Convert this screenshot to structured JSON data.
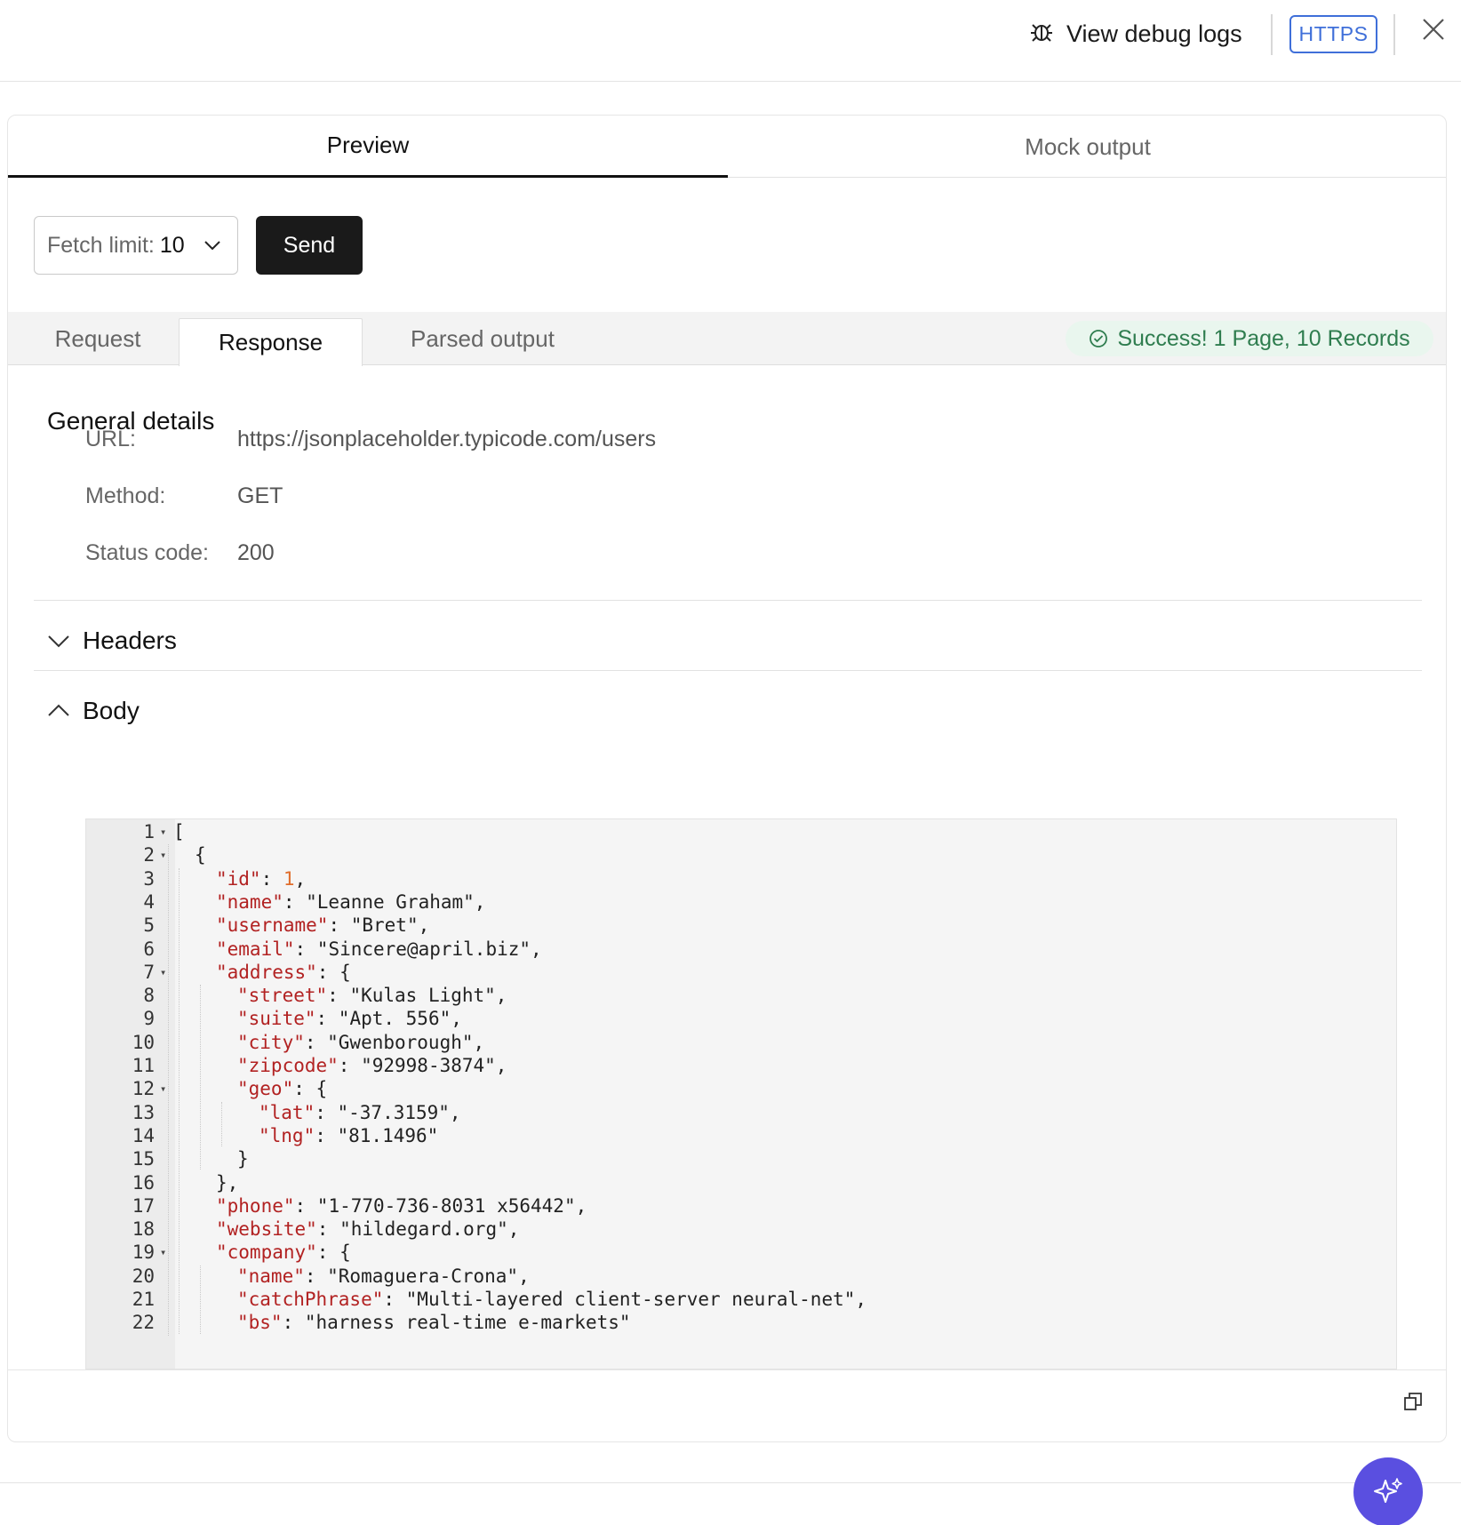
{
  "topbar": {
    "debug_label": "View debug logs",
    "https_label": "HTTPS"
  },
  "tabs": {
    "preview": "Preview",
    "mock": "Mock output"
  },
  "fetch": {
    "label": "Fetch limit:",
    "value": "10",
    "send_label": "Send"
  },
  "subtabs": {
    "request": "Request",
    "response": "Response",
    "parsed": "Parsed output",
    "success": "Success! 1 Page, 10 Records"
  },
  "general": {
    "title": "General details",
    "url_label": "URL:",
    "url_value": "https://jsonplaceholder.typicode.com/users",
    "method_label": "Method:",
    "method_value": "GET",
    "status_label": "Status code:",
    "status_value": "200"
  },
  "sections": {
    "headers": "Headers",
    "body": "Body"
  },
  "code": {
    "lines": [
      {
        "n": "1",
        "fold": true,
        "d": 0,
        "p": [
          [
            "t",
            "["
          ]
        ]
      },
      {
        "n": "2",
        "fold": true,
        "d": 1,
        "p": [
          [
            "t",
            "{"
          ]
        ]
      },
      {
        "n": "3",
        "fold": false,
        "d": 2,
        "p": [
          [
            "k",
            "\"id\""
          ],
          [
            "t",
            ": "
          ],
          [
            "n",
            "1"
          ],
          [
            "t",
            ","
          ]
        ]
      },
      {
        "n": "4",
        "fold": false,
        "d": 2,
        "p": [
          [
            "k",
            "\"name\""
          ],
          [
            "t",
            ": \"Leanne Graham\","
          ]
        ]
      },
      {
        "n": "5",
        "fold": false,
        "d": 2,
        "p": [
          [
            "k",
            "\"username\""
          ],
          [
            "t",
            ": \"Bret\","
          ]
        ]
      },
      {
        "n": "6",
        "fold": false,
        "d": 2,
        "p": [
          [
            "k",
            "\"email\""
          ],
          [
            "t",
            ": \"Sincere@april.biz\","
          ]
        ]
      },
      {
        "n": "7",
        "fold": true,
        "d": 2,
        "p": [
          [
            "k",
            "\"address\""
          ],
          [
            "t",
            ": {"
          ]
        ]
      },
      {
        "n": "8",
        "fold": false,
        "d": 3,
        "p": [
          [
            "k",
            "\"street\""
          ],
          [
            "t",
            ": \"Kulas Light\","
          ]
        ]
      },
      {
        "n": "9",
        "fold": false,
        "d": 3,
        "p": [
          [
            "k",
            "\"suite\""
          ],
          [
            "t",
            ": \"Apt. 556\","
          ]
        ]
      },
      {
        "n": "10",
        "fold": false,
        "d": 3,
        "p": [
          [
            "k",
            "\"city\""
          ],
          [
            "t",
            ": \"Gwenborough\","
          ]
        ]
      },
      {
        "n": "11",
        "fold": false,
        "d": 3,
        "p": [
          [
            "k",
            "\"zipcode\""
          ],
          [
            "t",
            ": \"92998-3874\","
          ]
        ]
      },
      {
        "n": "12",
        "fold": true,
        "d": 3,
        "p": [
          [
            "k",
            "\"geo\""
          ],
          [
            "t",
            ": {"
          ]
        ]
      },
      {
        "n": "13",
        "fold": false,
        "d": 4,
        "p": [
          [
            "k",
            "\"lat\""
          ],
          [
            "t",
            ": \"-37.3159\","
          ]
        ]
      },
      {
        "n": "14",
        "fold": false,
        "d": 4,
        "p": [
          [
            "k",
            "\"lng\""
          ],
          [
            "t",
            ": \"81.1496\""
          ]
        ]
      },
      {
        "n": "15",
        "fold": false,
        "d": 3,
        "p": [
          [
            "t",
            "}"
          ]
        ]
      },
      {
        "n": "16",
        "fold": false,
        "d": 2,
        "p": [
          [
            "t",
            "},"
          ]
        ]
      },
      {
        "n": "17",
        "fold": false,
        "d": 2,
        "p": [
          [
            "k",
            "\"phone\""
          ],
          [
            "t",
            ": \"1-770-736-8031 x56442\","
          ]
        ]
      },
      {
        "n": "18",
        "fold": false,
        "d": 2,
        "p": [
          [
            "k",
            "\"website\""
          ],
          [
            "t",
            ": \"hildegard.org\","
          ]
        ]
      },
      {
        "n": "19",
        "fold": true,
        "d": 2,
        "p": [
          [
            "k",
            "\"company\""
          ],
          [
            "t",
            ": {"
          ]
        ]
      },
      {
        "n": "20",
        "fold": false,
        "d": 3,
        "p": [
          [
            "k",
            "\"name\""
          ],
          [
            "t",
            ": \"Romaguera-Crona\","
          ]
        ]
      },
      {
        "n": "21",
        "fold": false,
        "d": 3,
        "p": [
          [
            "k",
            "\"catchPhrase\""
          ],
          [
            "t",
            ": \"Multi-layered client-server neural-net\","
          ]
        ]
      },
      {
        "n": "22",
        "fold": false,
        "d": 3,
        "p": [
          [
            "k",
            "\"bs\""
          ],
          [
            "t",
            ": \"harness real-time e-markets\""
          ]
        ]
      }
    ]
  },
  "icons": {
    "debug": "bug-icon",
    "close": "close-icon",
    "select": "chevron-down-icon",
    "success": "check-circle-icon",
    "headers": "chevron-down-icon",
    "body": "chevron-up-icon",
    "copy": "copy-icon",
    "ai": "sparkle-icon"
  },
  "colors": {
    "accent": "#3f6fd9",
    "success_text": "#2f7d4f",
    "success_bg": "#e9f6ee",
    "fab": "#5a4fe0",
    "json_key": "#b22222",
    "json_number": "#e06c2a"
  }
}
